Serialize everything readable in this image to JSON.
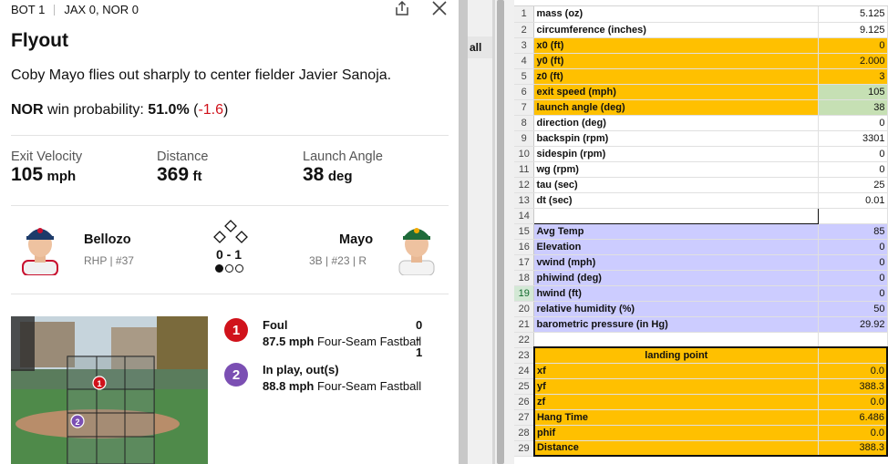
{
  "gamecast": {
    "inning": "BOT 1",
    "score": "JAX 0, NOR 0",
    "title": "Flyout",
    "description": "Coby Mayo flies out sharply to center fielder Javier Sanoja.",
    "win_prob": {
      "team": "NOR",
      "label": "win probability:",
      "value": "51.0%",
      "open": "(",
      "change": "-1.6",
      "close": ")"
    },
    "stats": [
      {
        "label": "Exit Velocity",
        "value": "105",
        "unit": "mph"
      },
      {
        "label": "Distance",
        "value": "369",
        "unit": "ft"
      },
      {
        "label": "Launch Angle",
        "value": "38",
        "unit": "deg"
      }
    ],
    "pitcher": {
      "name": "Bellozo",
      "pos": "RHP",
      "num": "#37"
    },
    "batter": {
      "name": "Mayo",
      "pos": "3B",
      "num": "#23",
      "hand": "R"
    },
    "count": "0 - 1",
    "outs": 1,
    "pitches": [
      {
        "num": "1",
        "result": "Foul",
        "count": "0 - 1",
        "speed": "87.5 mph",
        "type": "Four-Seam Fastball",
        "color": "#d0121b"
      },
      {
        "num": "2",
        "result": "In play, out(s)",
        "count": "",
        "speed": "88.8 mph",
        "type": "Four-Seam Fastball",
        "color": "#7b4fb3"
      }
    ],
    "zone_labels": [
      "1",
      "2"
    ]
  },
  "middle": {
    "tab": "all"
  },
  "sheet": {
    "colors": {
      "yellow": "#ffc000",
      "green": "#c6e0b4",
      "lavender": "#ccccff"
    },
    "selected_row": "19",
    "rows": [
      {
        "n": "1",
        "a": "mass (oz)",
        "b": "5.125",
        "style": ""
      },
      {
        "n": "2",
        "a": "circumference (inches)",
        "b": "9.125",
        "style": ""
      },
      {
        "n": "3",
        "a": "x0 (ft)",
        "b": "0",
        "style": "y"
      },
      {
        "n": "4",
        "a": "y0 (ft)",
        "b": "2.000",
        "style": "y"
      },
      {
        "n": "5",
        "a": "z0 (ft)",
        "b": "3",
        "style": "y"
      },
      {
        "n": "6",
        "a": "exit speed (mph)",
        "b": "105",
        "style": "yg"
      },
      {
        "n": "7",
        "a": "launch angle (deg)",
        "b": "38",
        "style": "yg"
      },
      {
        "n": "8",
        "a": "direction (deg)",
        "b": "0",
        "style": ""
      },
      {
        "n": "9",
        "a": "backspin (rpm)",
        "b": "3301",
        "style": ""
      },
      {
        "n": "10",
        "a": "sidespin (rpm)",
        "b": "0",
        "style": ""
      },
      {
        "n": "11",
        "a": "wg (rpm)",
        "b": "0",
        "style": ""
      },
      {
        "n": "12",
        "a": "tau (sec)",
        "b": "25",
        "style": ""
      },
      {
        "n": "13",
        "a": "dt (sec)",
        "b": "0.01",
        "style": ""
      },
      {
        "n": "14",
        "a": "",
        "b": "",
        "style": "r14"
      },
      {
        "n": "15",
        "a": "Avg Temp",
        "b": "85",
        "style": "l"
      },
      {
        "n": "16",
        "a": "Elevation",
        "b": "0",
        "style": "l"
      },
      {
        "n": "17",
        "a": "vwind (mph)",
        "b": "0",
        "style": "l"
      },
      {
        "n": "18",
        "a": "phiwind (deg)",
        "b": "0",
        "style": "l"
      },
      {
        "n": "19",
        "a": "hwind (ft)",
        "b": "0",
        "style": "l"
      },
      {
        "n": "20",
        "a": "relative humidity (%)",
        "b": "50",
        "style": "l"
      },
      {
        "n": "21",
        "a": "barometric pressure (in Hg)",
        "b": "29.92",
        "style": "l"
      },
      {
        "n": "22",
        "a": "",
        "b": "",
        "style": ""
      },
      {
        "n": "23",
        "a": "landing point",
        "b": "",
        "style": "hdr"
      },
      {
        "n": "24",
        "a": "xf",
        "b": "0.0",
        "style": "yb"
      },
      {
        "n": "25",
        "a": "yf",
        "b": "388.3",
        "style": "yb"
      },
      {
        "n": "26",
        "a": "zf",
        "b": "0.0",
        "style": "yb"
      },
      {
        "n": "27",
        "a": "Hang Time",
        "b": "6.486",
        "style": "yb"
      },
      {
        "n": "28",
        "a": "phif",
        "b": "0.0",
        "style": "yb"
      },
      {
        "n": "29",
        "a": "Distance",
        "b": "388.3",
        "style": "ybl"
      }
    ]
  }
}
